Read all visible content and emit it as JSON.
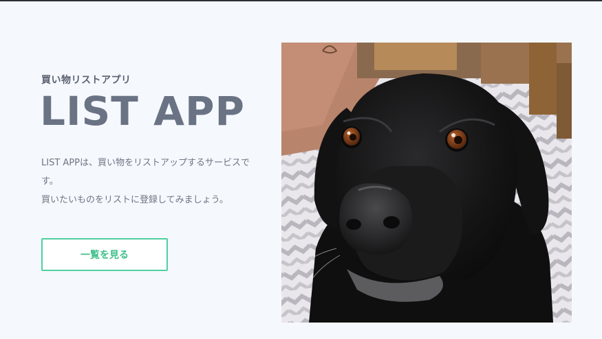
{
  "hero": {
    "subtitle": "買い物リストアプリ",
    "title": "LIST APP",
    "description_line1": "LIST APPは、買い物をリストアップするサービスです。",
    "description_line2": "買いたいものをリストに登録してみましょう。",
    "cta_label": "一覧を見る"
  },
  "image": {
    "subject": "black-labrador-dog-photo"
  },
  "colors": {
    "background": "#f5f8fd",
    "heading": "#6a7384",
    "accent": "#4fcf9e"
  }
}
